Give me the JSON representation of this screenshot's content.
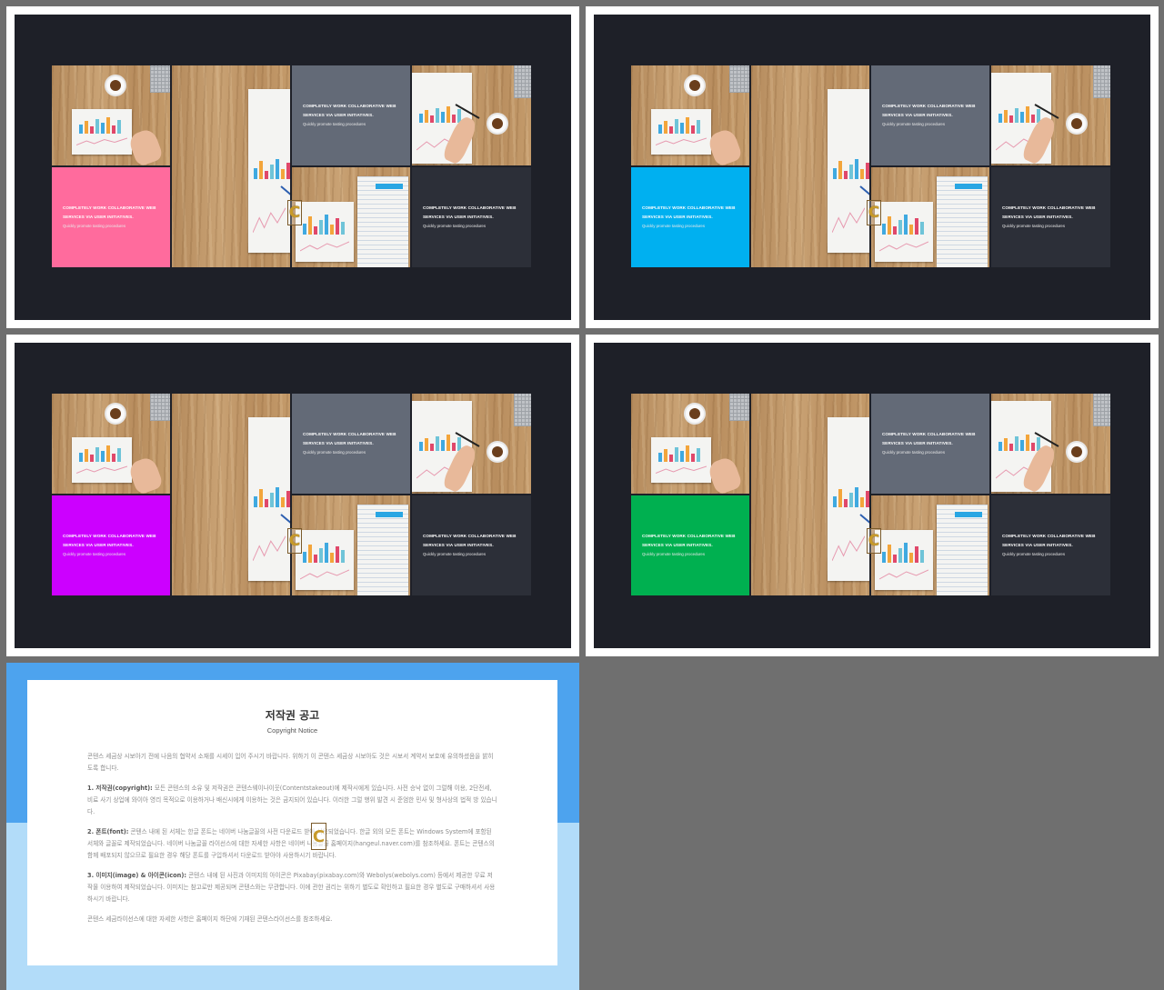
{
  "slides": [
    {
      "accent": "#ff6b9d"
    },
    {
      "accent": "#00b0f0"
    },
    {
      "accent": "#cc00ff"
    },
    {
      "accent": "#00b050"
    }
  ],
  "tile_text": {
    "line1": "COMPLETELY WORK COLLABORATIVE WEB",
    "line2": "SERVICES VIA USER  INITIATIVES.",
    "sub": "Quickly promote tasting procedures"
  },
  "logo_letter": "C",
  "copyright": {
    "title": "저작권 공고",
    "subtitle": "Copyright Notice",
    "paragraphs": [
      {
        "head": "",
        "text": "콘텐스 세금상 시보아기 전에 나음의 협약서 소재를 시세이 입어 주시기 바랍니다. 위하기 이 콘텐스 세금상 시보아도 것은 시보서 계약서 보호에 유의하셨음을 밝히도록 합니다."
      },
      {
        "head": "1. 저작권(copyright):",
        "text": " 모든 콘텐스의 소유 및 저작권은 콘텐스웨이나이웃(Contentstakeout)에 제작시에게 있습니다. 사전 승낙 없이 그럴해 이용, 2단전세, 비료 사기 상업에 와이아 영리 목적으로 이용하거나 배신시에게 이용하는 것은 금지되어 있습니다. 이러한 그럴 행위 발견 시 준엄한 민사 및 형사상의 법적 방 있습니다."
      },
      {
        "head": "2. 폰트(font):",
        "text": " 콘텐스 내에 된 서체는 한글 폰트는 네이버 나눔글꼴의 사전 다운로드 받아 사용되었습니다. 한글 외의 모든 폰트는 Windows System에 포함된 서체와 글꼴로 제작되었습니다. 네이버 나눔글꼴 라이선스에 대한 자세한 사항은 네이버 나눔글꼴 홈페이지(hangeul.naver.com)를 참조하세요. 폰트는 콘텐스의 함께 배포되지 않으므로 필요한 경우 해당 폰트를 구입하셔서 다운로드 받아야 사용하시기 바랍니다."
      },
      {
        "head": "3. 이미지(image) & 아이콘(icon):",
        "text": " 콘텐스 내에 된 사진과 이미지의 아이콘은 Pixabay(pixabay.com)와 Webolys(webolys.com) 등에서 제공한 무료 저작물 이용하여 제작되었습니다. 이미지는 참고로만 제공되며 콘텐스와는 무관합니다. 이에 관한 권리는 위하기 별도로 확인하고 필요한 경우 별도로 구매하셔서 사용하시기 바랍니다."
      },
      {
        "head": "",
        "text": "콘텐스 세금라이선스에 대한 자세한 사항은 홈페이지 하단에 기재된 콘텐스라이선스를 참조하세요."
      }
    ]
  }
}
